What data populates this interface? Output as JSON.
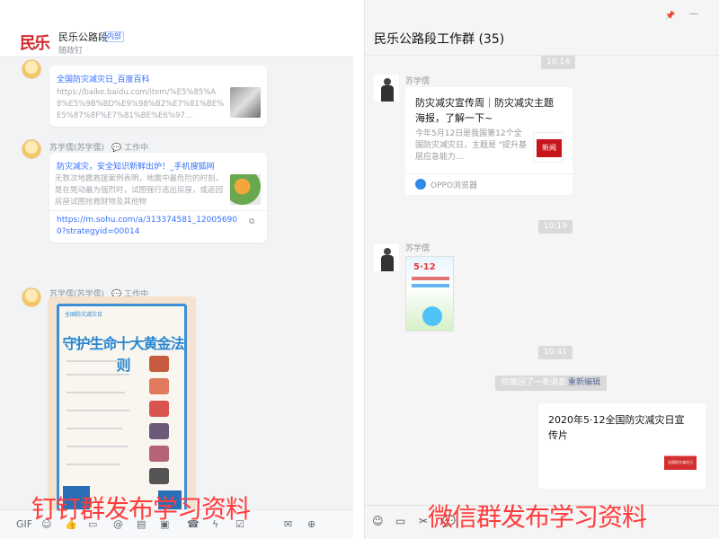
{
  "left": {
    "group_name": "民乐公路段",
    "tag": "内部",
    "subtitle": "随政钉",
    "logo_text": "民乐",
    "msg1": {
      "link_title": "全国防灾减灾日_百度百科",
      "url_preview": "https://baike.baidu.com/item/%E5%85%A8%E5%9B%BD%E9%98%B2%E7%81%BE%E5%87%8F%E7%81%BE%E6%97..."
    },
    "msg2": {
      "sender": "苏学儒(苏学儒)",
      "status": "工作中",
      "link_title": "防灾减灾，安全知识新鲜出炉！_手机搜狐网",
      "desc": "无数次地震救援案例表明，地震中最危险的时刻，是在晃动最为强烈时，试图强行逃出房屋，或返回房屋试图抢救财物及其他物",
      "url": "https://m.sohu.com/a/313374581_120056900?strategyid=00014"
    },
    "msg3": {
      "sender": "苏学儒(苏学儒)",
      "status": "工作中",
      "poster_title": "守护生命十大黄金法则",
      "poster_badge": "全国防灾减灾日"
    },
    "toolbar_icons": [
      "gif-icon",
      "emoji-icon",
      "like-icon",
      "folder-icon",
      "at-icon",
      "doc-icon",
      "image-icon",
      "phone-icon",
      "flash-icon",
      "task-icon",
      "mail-icon",
      "more-icon"
    ]
  },
  "right": {
    "group_title": "民乐公路段工作群 (35)",
    "timestamps": [
      "10:14",
      "10:19",
      "10:41"
    ],
    "msg1": {
      "sender": "苏学儒",
      "title": "防灾减灾宣传周｜防灾减灾主题海报，了解一下~",
      "desc": "今年5月12日是我国第12个全国防灾减灾日，主题是 \"提升基层应急能力...",
      "source": "OPPO浏览器",
      "thumb_text": "新闻"
    },
    "msg2": {
      "sender": "苏学儒",
      "image_text": "5·12"
    },
    "recall_text": "你撤回了一条消息",
    "recall_edit": "重新编辑",
    "msg3": {
      "title": "2020年5·12全国防灾减灾日宣传片",
      "thumb_text": "全国防灾减灾日"
    },
    "toolbar_icons": [
      "emoji-icon",
      "folder-icon",
      "scissors-icon",
      "chat-icon"
    ]
  },
  "captions": {
    "left": "钉钉群发布学习资料",
    "right": "微信群发布学习资料"
  },
  "colors": {
    "dingtalk_link": "#3370ff",
    "wechat_link": "#576b95",
    "caption_red": "#ff3d3d",
    "logo_red": "#d4282d"
  }
}
